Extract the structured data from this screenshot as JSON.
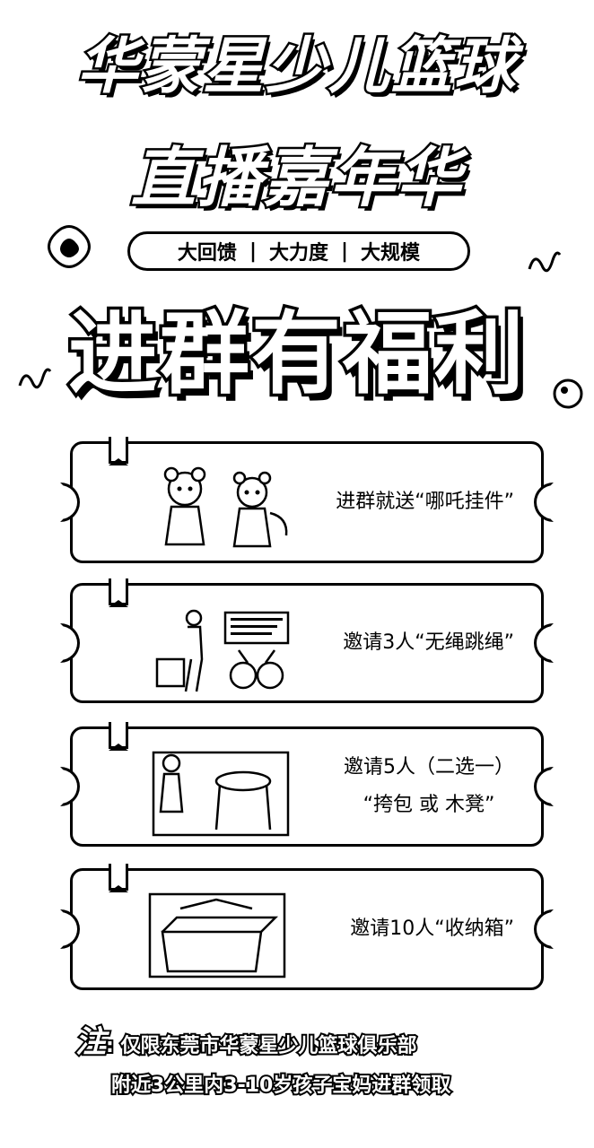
{
  "header": {
    "title_line1": "华蒙星少儿篮球",
    "title_line2": "直播嘉年华",
    "tags": [
      "大回馈",
      "大力度",
      "大规模"
    ],
    "tag_separator": "|",
    "headline": "进群有福利"
  },
  "rewards": [
    {
      "lines": [
        "进群就送“哪吒挂件”"
      ],
      "image": "nezha-pendants"
    },
    {
      "lines": [
        "邀请3人“无绳跳绳”"
      ],
      "image": "cordless-skipping-rope"
    },
    {
      "lines": [
        "邀请5人（二选一）",
        "“挎包 或 木凳”"
      ],
      "image": "bag-or-stool"
    },
    {
      "lines": [
        "邀请10人“收纳箱”"
      ],
      "image": "storage-box"
    }
  ],
  "note": {
    "label": "注",
    "colon": ":",
    "line1": "仅限东莞市华蒙星少儿篮球俱乐部",
    "line2": "附近3公里内3-10岁孩子宝妈进群领取"
  },
  "colors": {
    "background": "#ffffff",
    "ink": "#000000"
  }
}
